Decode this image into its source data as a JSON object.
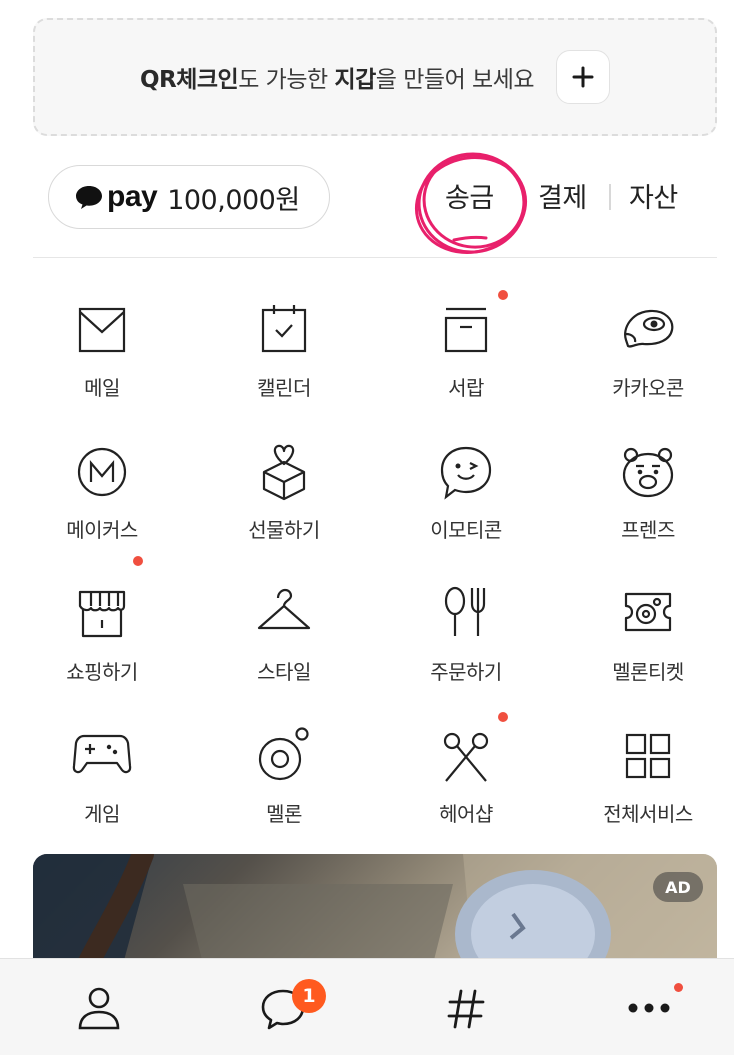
{
  "banner": {
    "text_strong1": "QR체크인",
    "text_mid1": "도 가능한 ",
    "text_strong2": "지갑",
    "text_mid2": "을 만들어 보세요",
    "add_icon": "plus-icon"
  },
  "pay": {
    "logo": "pay",
    "balance": "100,000원",
    "logo_icon": "speech-bubble-icon"
  },
  "finance_tabs": [
    {
      "label": "송금",
      "annotated": true
    },
    {
      "label": "결제"
    },
    {
      "label": "자산"
    }
  ],
  "annotation_color": "#e8206b",
  "services": [
    {
      "label": "메일",
      "icon": "mail-icon"
    },
    {
      "label": "캘린더",
      "icon": "calendar-icon"
    },
    {
      "label": "서랍",
      "icon": "drawer-icon",
      "new": true
    },
    {
      "label": "카카오콘",
      "icon": "kakaocon-icon"
    },
    {
      "label": "메이커스",
      "icon": "makers-icon"
    },
    {
      "label": "선물하기",
      "icon": "gift-icon"
    },
    {
      "label": "이모티콘",
      "icon": "emoticon-icon"
    },
    {
      "label": "프렌즈",
      "icon": "friends-icon"
    },
    {
      "label": "쇼핑하기",
      "icon": "shop-icon",
      "new": true
    },
    {
      "label": "스타일",
      "icon": "hanger-icon"
    },
    {
      "label": "주문하기",
      "icon": "fork-spoon-icon"
    },
    {
      "label": "멜론티켓",
      "icon": "ticket-icon"
    },
    {
      "label": "게임",
      "icon": "gamepad-icon"
    },
    {
      "label": "멜론",
      "icon": "melon-icon"
    },
    {
      "label": "헤어샵",
      "icon": "scissors-icon",
      "new": true
    },
    {
      "label": "전체서비스",
      "icon": "grid-icon"
    }
  ],
  "ad": {
    "badge": "AD"
  },
  "bottom_nav": {
    "items": [
      "friends-tab-icon",
      "chats-tab-icon",
      "hashtag-tab-icon",
      "more-tab-icon"
    ],
    "chat_badge": "1"
  },
  "colors": {
    "badge": "#ff5a1f",
    "new_dot": "#f04f3f",
    "text": "#1e1e1e"
  }
}
